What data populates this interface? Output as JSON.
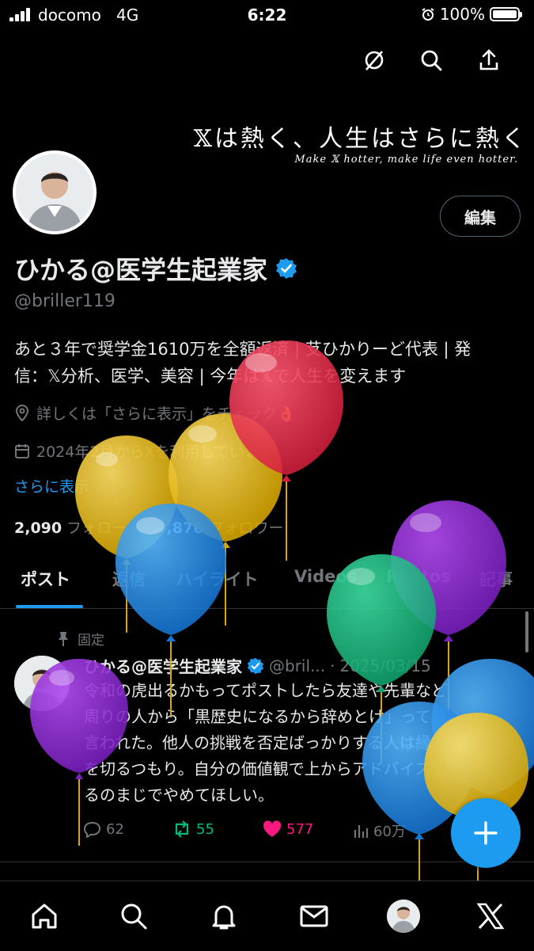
{
  "status_bar": {
    "carrier": "docomo",
    "network": "4G",
    "time": "6:22",
    "battery": "100%"
  },
  "header": {
    "icons": [
      "grok-icon",
      "search-icon",
      "share-icon"
    ]
  },
  "banner": {
    "jp": "𝕏は熱く、人生はさらに熱く",
    "en": "Make 𝕏 hotter, make life even hotter."
  },
  "profile": {
    "edit_label": "編集",
    "name": "ひかる@医学生起業家",
    "handle": "@briller119",
    "bio_line1": "あと３年で奨学金1610万を全額返済 | 𦫿ひかりーど代表 | 発",
    "bio_line2": "信：𝕏分析、医学、美容 | 今年は𝕏で人生を変えます",
    "location": "詳しくは「さらに表示」をチェック👌",
    "joined": "2024年2月からXを利用しています",
    "show_more": "さらに表示",
    "following_count": "2,090",
    "following_label": "フォロー中",
    "followers_count": "4,876",
    "followers_label": "フォロワー"
  },
  "tabs": [
    "ポスト",
    "返信",
    "ハイライト",
    "Videos",
    "Photos",
    "記事"
  ],
  "post": {
    "pinned_label": "固定",
    "name": "ひかる@医学生起業家",
    "handle": "@bril...",
    "date": "2025/03/15",
    "lines": [
      "令和の虎出るかもってポストしたら友達や先輩など",
      "周りの人から「黒歴史になるから辞めとけ」って",
      "言われた。他人の挑戦を否定ばっかりする人は縁",
      "を切るつもり。自分の価値観で上からアドバイスす",
      "るのまじでやめてほしい。"
    ],
    "replies": "62",
    "reposts": "55",
    "likes": "577",
    "views": "60万"
  },
  "colors": {
    "accent": "#1d9bf0",
    "like": "#f91880",
    "repost": "#00ba7c",
    "muted": "#71767b"
  },
  "bottom_nav": [
    "home-icon",
    "search-icon",
    "bell-icon",
    "mail-icon",
    "profile-avatar",
    "x-logo-icon"
  ]
}
